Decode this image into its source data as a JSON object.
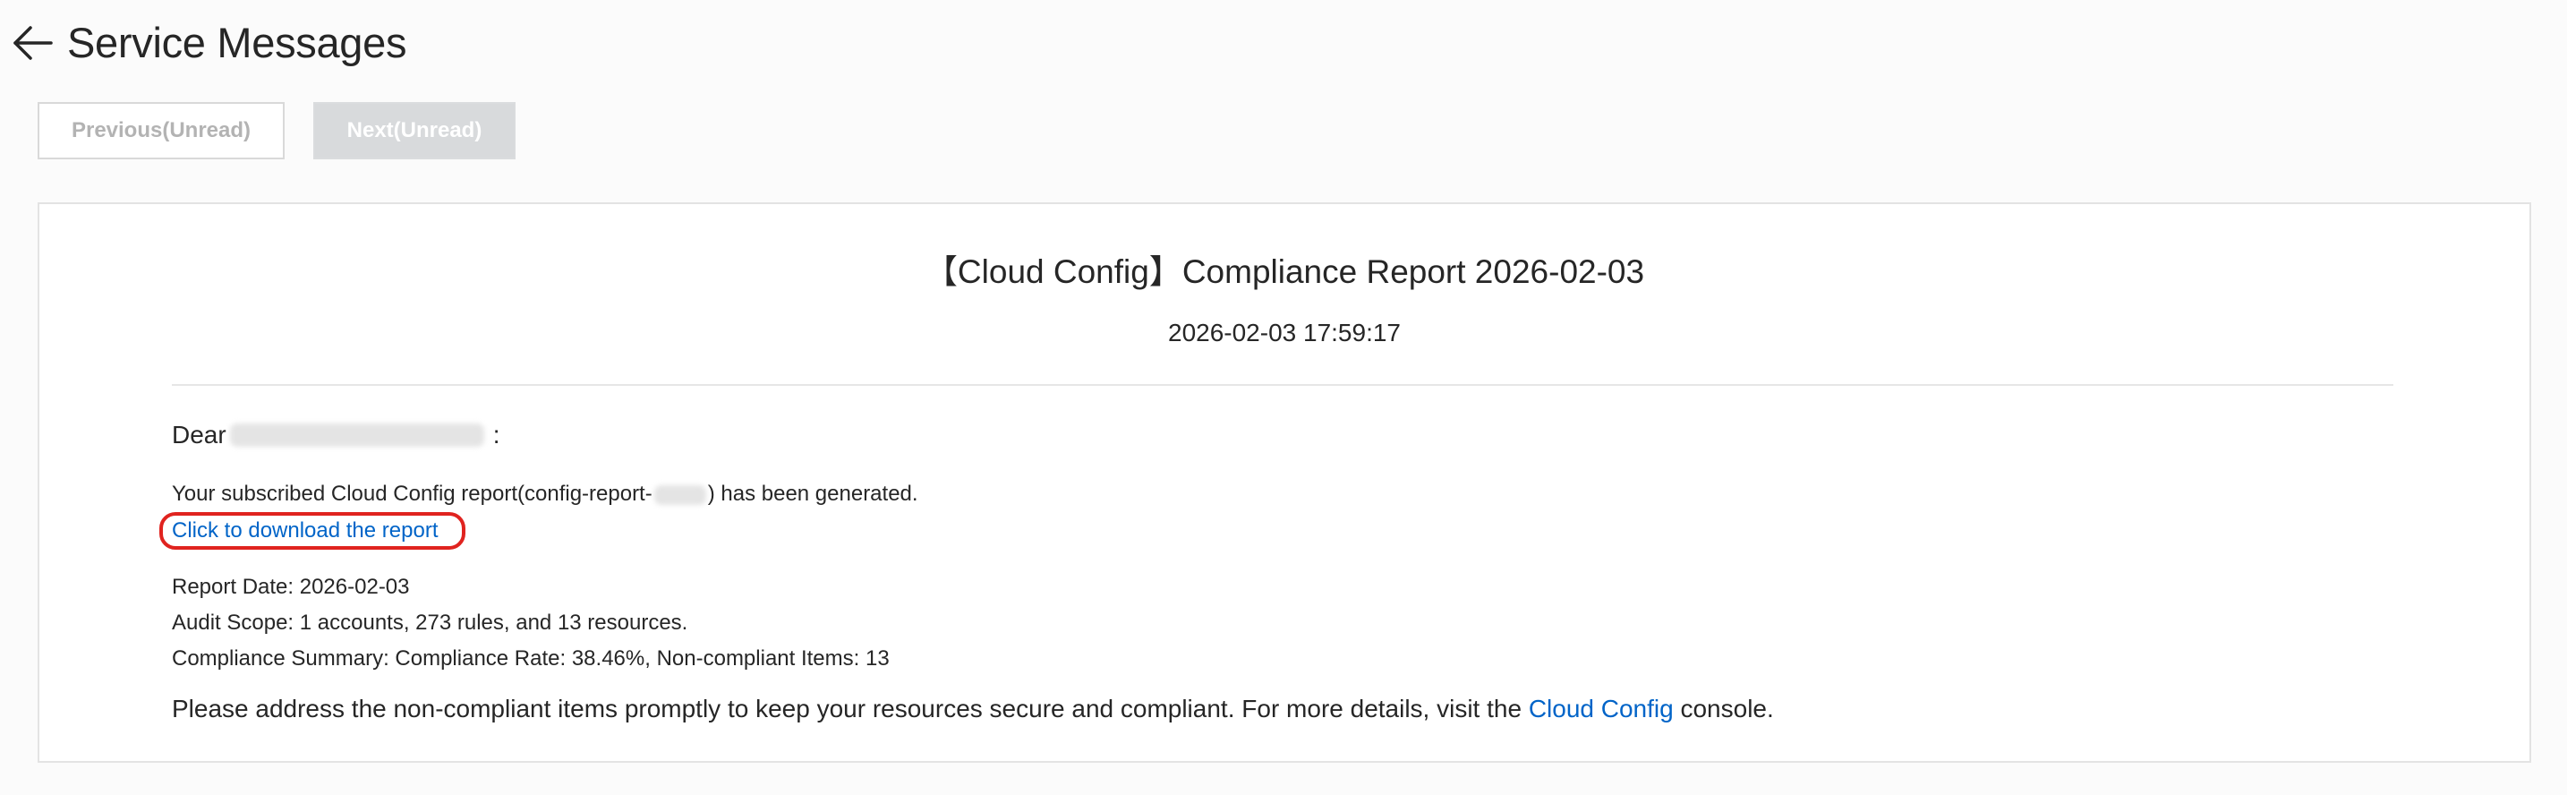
{
  "header": {
    "back_icon": "arrow-left-icon",
    "title": "Service Messages"
  },
  "nav": {
    "previous_label": "Previous(Unread)",
    "next_label": "Next(Unread)"
  },
  "message": {
    "title": "【Cloud Config】Compliance Report 2026-02-03",
    "timestamp": "2026-02-03 17:59:17",
    "greeting_prefix": "Dear",
    "greeting_suffix": ":",
    "subscribed_prefix": "Your subscribed Cloud Config report(config-report-",
    "subscribed_suffix": ") has been generated.",
    "download_link": "Click to download the report",
    "report_date": "Report Date: 2026-02-03",
    "audit_scope": "Audit Scope: 1 accounts, 273 rules, and 13 resources.",
    "compliance_summary": "Compliance Summary: Compliance Rate: 38.46%, Non-compliant Items: 13",
    "address_prefix": "Please address the non-compliant items promptly to keep your resources secure and compliant. For more details, visit the ",
    "address_link": "Cloud Config",
    "address_suffix": " console."
  },
  "colors": {
    "link": "#0064c8",
    "highlight_border": "#e0231f",
    "disabled_button_bg": "#d8dadc"
  }
}
